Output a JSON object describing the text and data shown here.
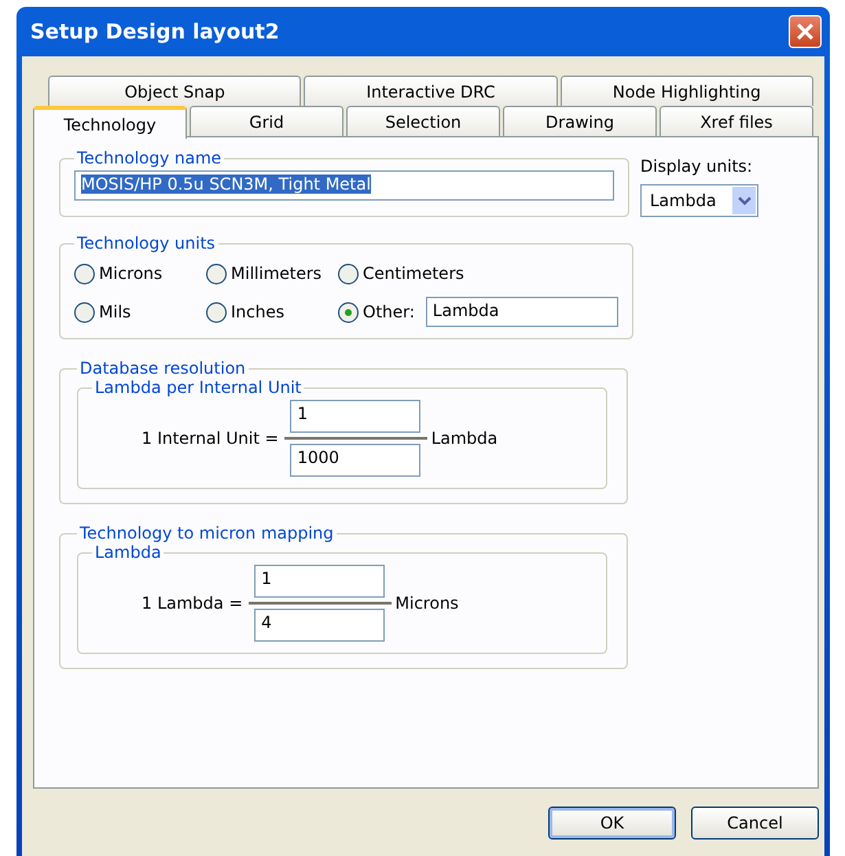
{
  "window": {
    "title": "Setup Design layout2"
  },
  "tab_rows": [
    [
      {
        "label": "Object Snap",
        "selected": false
      },
      {
        "label": "Interactive DRC",
        "selected": false
      },
      {
        "label": "Node Highlighting",
        "selected": false
      }
    ],
    [
      {
        "label": "Technology",
        "selected": true
      },
      {
        "label": "Grid",
        "selected": false
      },
      {
        "label": "Selection",
        "selected": false
      },
      {
        "label": "Drawing",
        "selected": false
      },
      {
        "label": "Xref files",
        "selected": false
      }
    ]
  ],
  "technology_name": {
    "legend": "Technology name",
    "value": "MOSIS/HP 0.5u SCN3M, Tight Metal",
    "text_selected": true
  },
  "display_units": {
    "label": "Display units:",
    "value": "Lambda"
  },
  "technology_units": {
    "legend": "Technology units",
    "options": [
      {
        "kind": "radio",
        "label": "Microns",
        "selected": false
      },
      {
        "kind": "radio",
        "label": "Millimeters",
        "selected": false
      },
      {
        "kind": "radio",
        "label": "Centimeters",
        "selected": false
      },
      {
        "kind": "radio",
        "label": "Mils",
        "selected": false
      },
      {
        "kind": "radio",
        "label": "Inches",
        "selected": false
      },
      {
        "kind": "radio_field",
        "label": "Other:",
        "selected": true,
        "value": "Lambda"
      }
    ]
  },
  "ratios": [
    {
      "legend": "Database resolution",
      "inner_legend": "Lambda per Internal Unit",
      "left_label": "1 Internal Unit =",
      "numerator": "1",
      "denominator": "1000",
      "right_label": "Lambda"
    },
    {
      "legend": "Technology to micron mapping",
      "inner_legend": "Lambda",
      "left_label": "1 Lambda =",
      "numerator": "1",
      "denominator": "4",
      "right_label": "Microns"
    }
  ],
  "buttons": [
    {
      "label": "OK",
      "default": true
    },
    {
      "label": "Cancel",
      "default": false
    }
  ]
}
